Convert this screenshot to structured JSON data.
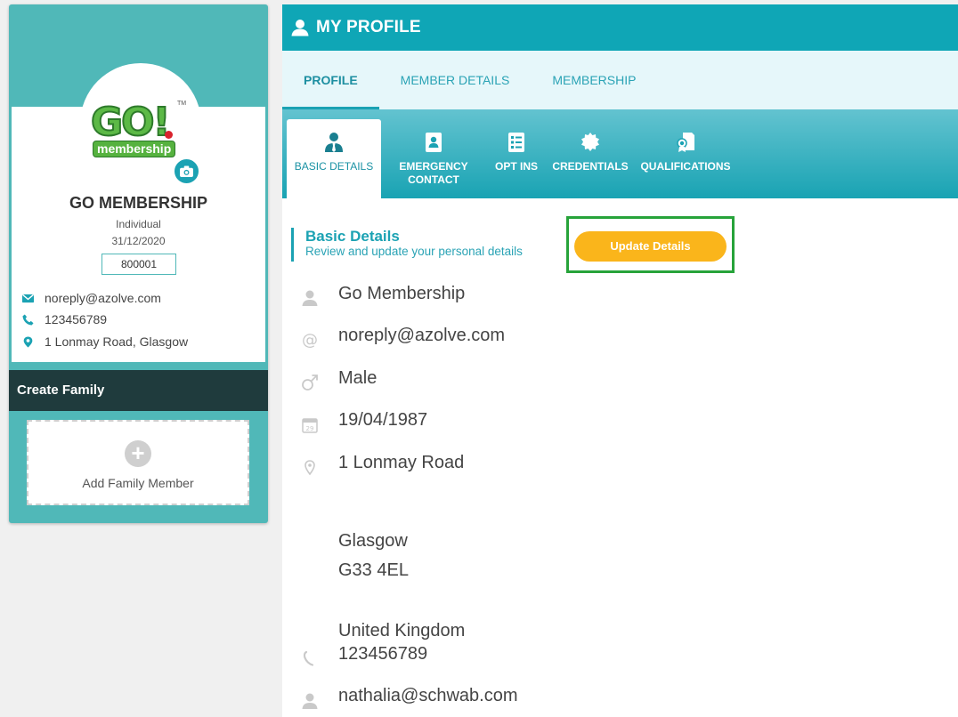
{
  "profile": {
    "logo_text": "GO!",
    "logo_subtext": "membership",
    "logo_tm": "TM",
    "name": "GO MEMBERSHIP",
    "type": "Individual",
    "date": "31/12/2020",
    "member_id": "800001",
    "email": "noreply@azolve.com",
    "phone": "123456789",
    "address": "1 Lonmay Road, Glasgow"
  },
  "family": {
    "create_label": "Create Family",
    "add_label": "Add Family Member"
  },
  "header": {
    "title": "MY PROFILE"
  },
  "tabs": [
    {
      "label": "PROFILE"
    },
    {
      "label": "MEMBER DETAILS"
    },
    {
      "label": "MEMBERSHIP"
    }
  ],
  "subtabs": [
    {
      "label": "BASIC DETAILS",
      "icon": "user-tie-icon"
    },
    {
      "label": "EMERGENCY CONTACT",
      "icon": "contact-card-icon"
    },
    {
      "label": "OPT INS",
      "icon": "checklist-icon"
    },
    {
      "label": "CREDENTIALS",
      "icon": "badge-icon"
    },
    {
      "label": "QUALIFICATIONS",
      "icon": "certificate-icon"
    }
  ],
  "section": {
    "title": "Basic Details",
    "subtitle": "Review and update your personal details",
    "update_label": "Update Details"
  },
  "details": {
    "name": "Go Membership",
    "email": "noreply@azolve.com",
    "gender": "Male",
    "dob": "19/04/1987",
    "address_line1": "1 Lonmay Road",
    "city": "Glasgow",
    "postcode": "G33 4EL",
    "country": "United Kingdom",
    "phone": "123456789",
    "secondary_email": "nathalia@schwab.com"
  },
  "colors": {
    "teal": "#0fa6b6",
    "teal_light": "#50b8b8",
    "dark": "#1f3b3d",
    "orange": "#fab51b",
    "highlight_green": "#27a33a"
  }
}
